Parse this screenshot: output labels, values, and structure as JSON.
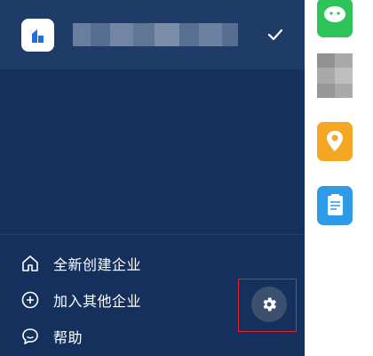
{
  "drawer": {
    "org_name": "",
    "menu": [
      {
        "label": "全新创建企业",
        "icon": "home-icon"
      },
      {
        "label": "加入其他企业",
        "icon": "plus-circle-icon"
      },
      {
        "label": "帮助",
        "icon": "chat-bubble-icon"
      }
    ],
    "settings_icon": "gear-icon"
  },
  "background_apps": [
    {
      "icon": "chat-app-icon",
      "color": "#2fc45a"
    },
    {
      "icon": "blurred-app-icon",
      "color": "#9b9b9b"
    },
    {
      "icon": "location-app-icon",
      "color": "#f5a623"
    },
    {
      "icon": "clipboard-app-icon",
      "color": "#2f9ae6"
    }
  ],
  "colors": {
    "drawer_bg": "#15305c",
    "header_bg": "#1f3c68",
    "highlight": "#e0242a"
  }
}
